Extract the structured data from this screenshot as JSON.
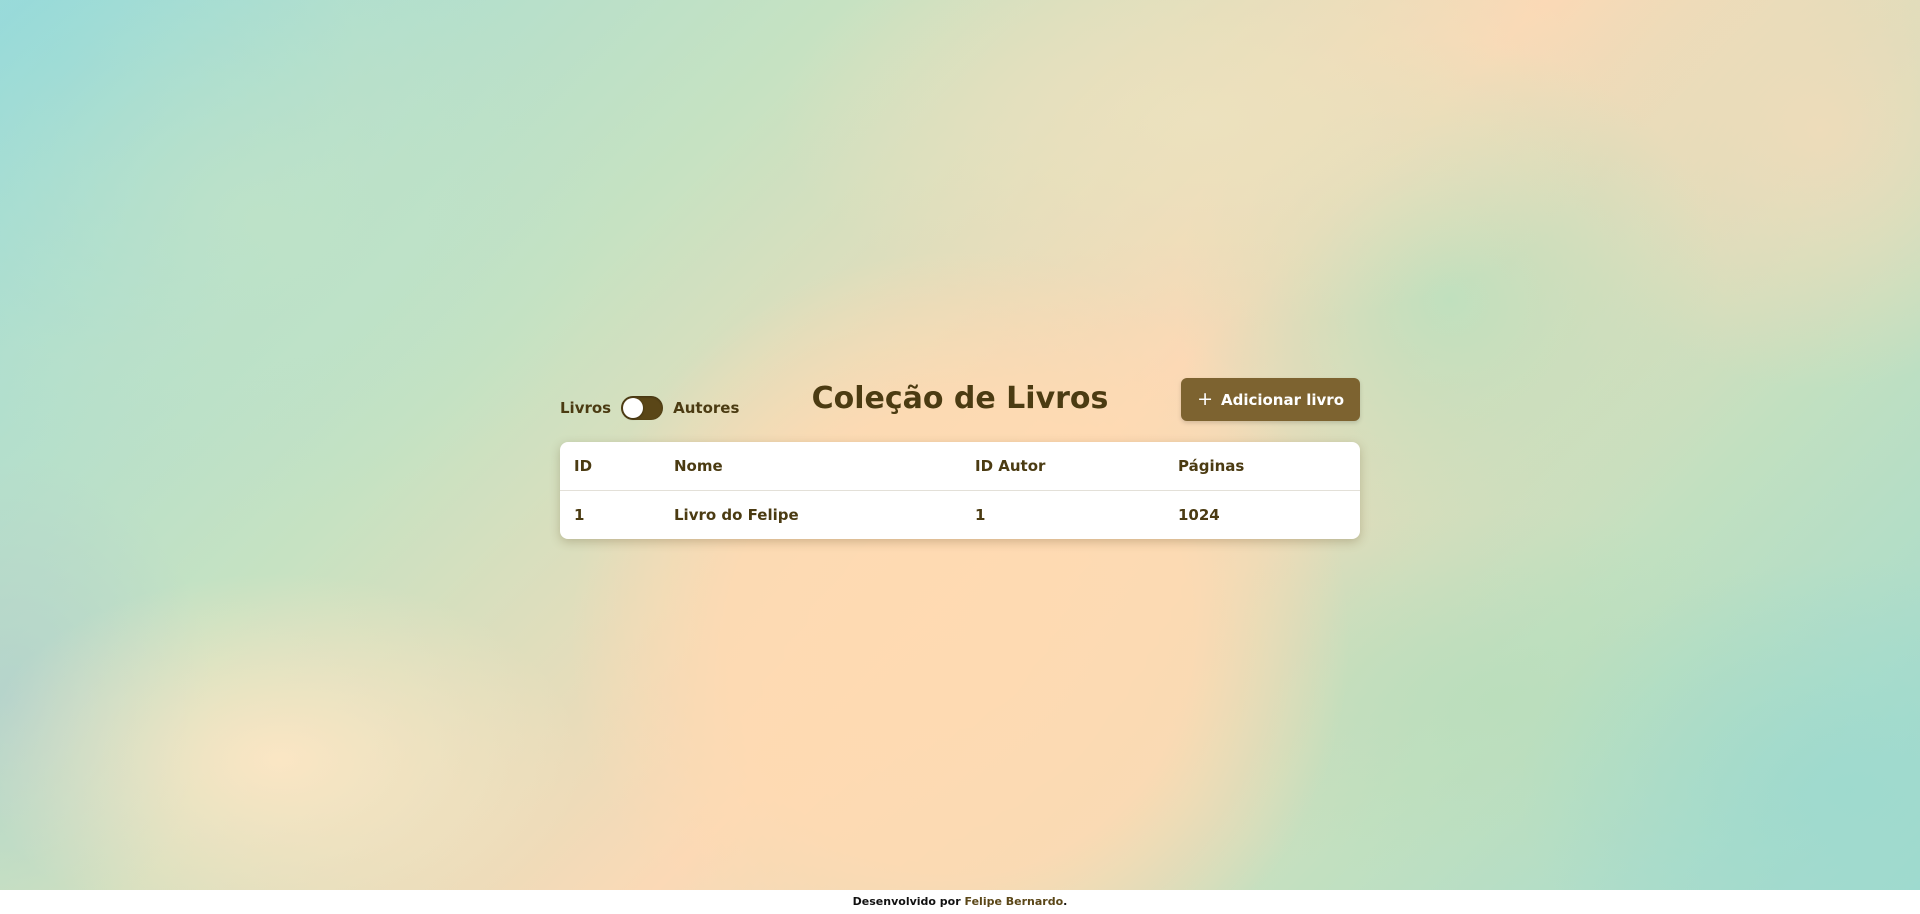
{
  "header": {
    "toggle_left_label": "Livros",
    "toggle_right_label": "Autores",
    "title": "Coleção de Livros",
    "add_button_label": "Adicionar livro",
    "add_button_icon": "plus-icon"
  },
  "table": {
    "columns": [
      "ID",
      "Nome",
      "ID Autor",
      "Páginas"
    ],
    "rows": [
      [
        "1",
        "Livro do Felipe",
        "1",
        "1024"
      ]
    ]
  },
  "footer": {
    "prefix": "Desenvolvido por",
    "author": "Felipe Bernardo",
    "suffix": "."
  },
  "colors": {
    "accent": "#7d6330",
    "text": "#4b3b12",
    "toggle": "#5a4617"
  }
}
